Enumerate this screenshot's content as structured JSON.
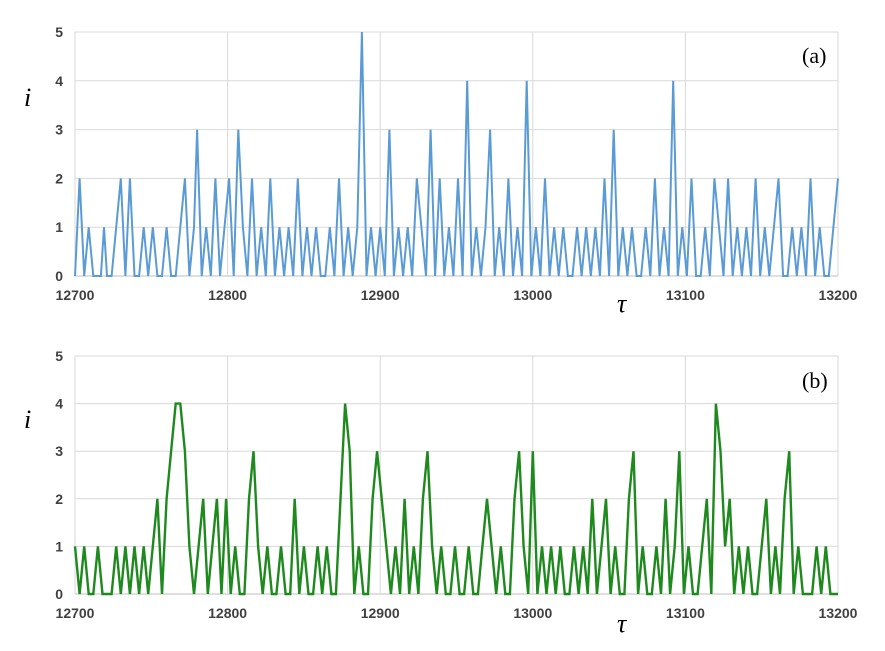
{
  "chart_data": [
    {
      "type": "line",
      "panel_label": "(a)",
      "xlabel": "τ",
      "ylabel": "i",
      "xlim": [
        12700,
        13200
      ],
      "ylim": [
        0,
        5
      ],
      "xticks": [
        12700,
        12800,
        12900,
        13000,
        13100,
        13200
      ],
      "yticks": [
        0,
        1,
        2,
        3,
        4,
        5
      ],
      "grid": true,
      "color": "#5b9bd5",
      "series": [
        {
          "x": [
            12700,
            12703,
            12706,
            12709,
            12712,
            12715,
            12717,
            12719,
            12721,
            12724,
            12727,
            12730,
            12733,
            12736,
            12739,
            12742,
            12745,
            12748,
            12751,
            12754,
            12757,
            12760,
            12763,
            12766,
            12769,
            12772,
            12775,
            12778,
            12780,
            12783,
            12786,
            12789,
            12792,
            12795,
            12798,
            12801,
            12804,
            12807,
            12810,
            12813,
            12816,
            12819,
            12822,
            12825,
            12828,
            12831,
            12834,
            12837,
            12840,
            12843,
            12846,
            12849,
            12852,
            12855,
            12858,
            12861,
            12864,
            12867,
            12870,
            12873,
            12876,
            12879,
            12882,
            12885,
            12888,
            12891,
            12894,
            12897,
            12900,
            12903,
            12906,
            12909,
            12912,
            12915,
            12918,
            12921,
            12924,
            12927,
            12930,
            12933,
            12936,
            12939,
            12942,
            12945,
            12948,
            12951,
            12954,
            12957,
            12960,
            12963,
            12966,
            12969,
            12972,
            12975,
            12978,
            12981,
            12984,
            12987,
            12990,
            12993,
            12996,
            12999,
            13002,
            13005,
            13008,
            13011,
            13014,
            13017,
            13020,
            13023,
            13026,
            13029,
            13032,
            13035,
            13038,
            13041,
            13044,
            13047,
            13050,
            13053,
            13056,
            13059,
            13062,
            13065,
            13068,
            13071,
            13074,
            13077,
            13080,
            13083,
            13086,
            13089,
            13092,
            13095,
            13098,
            13101,
            13104,
            13107,
            13110,
            13113,
            13116,
            13119,
            13122,
            13125,
            13128,
            13131,
            13134,
            13137,
            13140,
            13143,
            13146,
            13149,
            13152,
            13155,
            13158,
            13161,
            13164,
            13167,
            13170,
            13173,
            13176,
            13179,
            13182,
            13185,
            13188,
            13191,
            13194,
            13197,
            13200
          ],
          "y": [
            0,
            2,
            0,
            1,
            0,
            0,
            0,
            1,
            0,
            0,
            1,
            2,
            0,
            2,
            0,
            0,
            1,
            0,
            1,
            0,
            0,
            1,
            0,
            0,
            1,
            2,
            0,
            1,
            3,
            0,
            1,
            0,
            2,
            0,
            1,
            2,
            0,
            3,
            1,
            0,
            2,
            0,
            1,
            0,
            2,
            0,
            1,
            0,
            1,
            0,
            2,
            0,
            1,
            0,
            1,
            0,
            0,
            1,
            0,
            2,
            0,
            1,
            0,
            1,
            5,
            0,
            1,
            0,
            1,
            0,
            3,
            0,
            1,
            0,
            1,
            0,
            2,
            1,
            0,
            3,
            0,
            2,
            0,
            1,
            0,
            2,
            0,
            4,
            0,
            1,
            0,
            1,
            3,
            0,
            1,
            0,
            2,
            0,
            1,
            0,
            4,
            0,
            1,
            0,
            2,
            0,
            1,
            0,
            1,
            0,
            0,
            1,
            0,
            1,
            0,
            1,
            0,
            2,
            0,
            3,
            0,
            1,
            0,
            1,
            0,
            0,
            1,
            0,
            2,
            0,
            1,
            0,
            4,
            0,
            1,
            0,
            2,
            0,
            0,
            1,
            0,
            2,
            1,
            0,
            2,
            0,
            1,
            0,
            1,
            0,
            2,
            0,
            1,
            0,
            1,
            2,
            0,
            0,
            1,
            0,
            1,
            0,
            2,
            0,
            1,
            0,
            0,
            1,
            2
          ]
        }
      ]
    },
    {
      "type": "line",
      "panel_label": "(b)",
      "xlabel": "τ",
      "ylabel": "i",
      "xlim": [
        12700,
        13200
      ],
      "ylim": [
        0,
        5
      ],
      "xticks": [
        12700,
        12800,
        12900,
        13000,
        13100,
        13200
      ],
      "yticks": [
        0,
        1,
        2,
        3,
        4,
        5
      ],
      "grid": true,
      "color": "#1e8a1e",
      "series": [
        {
          "x": [
            12700,
            12703,
            12706,
            12709,
            12712,
            12715,
            12718,
            12721,
            12724,
            12727,
            12730,
            12733,
            12736,
            12739,
            12742,
            12745,
            12748,
            12751,
            12754,
            12757,
            12760,
            12763,
            12766,
            12769,
            12772,
            12775,
            12778,
            12781,
            12784,
            12787,
            12790,
            12793,
            12796,
            12799,
            12802,
            12805,
            12808,
            12811,
            12814,
            12817,
            12820,
            12823,
            12826,
            12829,
            12832,
            12835,
            12838,
            12841,
            12844,
            12847,
            12850,
            12853,
            12856,
            12859,
            12862,
            12865,
            12868,
            12871,
            12874,
            12877,
            12880,
            12883,
            12886,
            12889,
            12892,
            12895,
            12898,
            12901,
            12904,
            12907,
            12910,
            12913,
            12916,
            12919,
            12922,
            12925,
            12928,
            12931,
            12934,
            12937,
            12940,
            12943,
            12946,
            12949,
            12952,
            12955,
            12958,
            12961,
            12964,
            12967,
            12970,
            12973,
            12976,
            12979,
            12982,
            12985,
            12988,
            12991,
            12994,
            12997,
            13000,
            13003,
            13006,
            13009,
            13012,
            13015,
            13018,
            13021,
            13024,
            13027,
            13030,
            13033,
            13036,
            13039,
            13042,
            13045,
            13048,
            13051,
            13054,
            13057,
            13060,
            13063,
            13066,
            13069,
            13072,
            13075,
            13078,
            13081,
            13084,
            13087,
            13090,
            13093,
            13096,
            13099,
            13102,
            13105,
            13108,
            13111,
            13114,
            13117,
            13120,
            13123,
            13126,
            13129,
            13132,
            13135,
            13138,
            13141,
            13144,
            13147,
            13150,
            13153,
            13156,
            13159,
            13162,
            13165,
            13168,
            13171,
            13174,
            13177,
            13180,
            13183,
            13186,
            13189,
            13192,
            13195,
            13198,
            13200
          ],
          "y": [
            1,
            0,
            1,
            0,
            0,
            1,
            0,
            0,
            0,
            1,
            0,
            1,
            0,
            1,
            0,
            1,
            0,
            1,
            2,
            0,
            2,
            3,
            4,
            4,
            3,
            1,
            0,
            1,
            2,
            0,
            1,
            2,
            0,
            2,
            0,
            1,
            0,
            0,
            2,
            3,
            1,
            0,
            1,
            0,
            0,
            1,
            0,
            0,
            2,
            0,
            1,
            0,
            0,
            1,
            0,
            1,
            0,
            0,
            2,
            4,
            3,
            0,
            1,
            0,
            0,
            2,
            3,
            2,
            1,
            0,
            1,
            0,
            2,
            0,
            1,
            0,
            2,
            3,
            1,
            0,
            1,
            0,
            0,
            1,
            0,
            0,
            1,
            0,
            0,
            1,
            2,
            1,
            0,
            1,
            0,
            0,
            2,
            3,
            1,
            0,
            3,
            0,
            1,
            0,
            1,
            0,
            1,
            0,
            0,
            1,
            0,
            1,
            0,
            2,
            0,
            1,
            2,
            0,
            1,
            0,
            0,
            2,
            3,
            0,
            1,
            0,
            0,
            1,
            0,
            2,
            0,
            1,
            3,
            0,
            1,
            0,
            0,
            1,
            2,
            0,
            4,
            3,
            1,
            2,
            0,
            1,
            0,
            1,
            0,
            0,
            1,
            2,
            0,
            1,
            0,
            2,
            3,
            0,
            1,
            0,
            0,
            0,
            1,
            0,
            1,
            0,
            0,
            0
          ]
        }
      ]
    }
  ]
}
